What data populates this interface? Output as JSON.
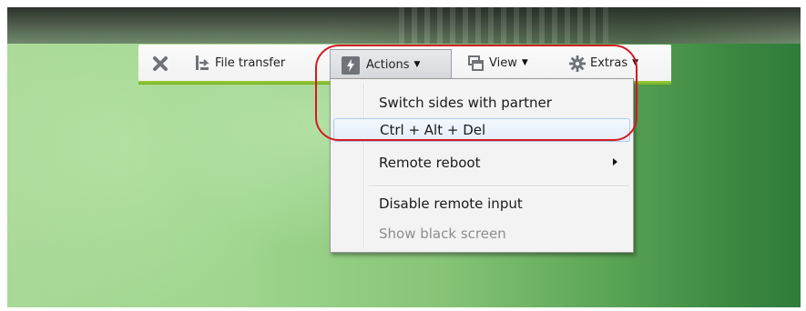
{
  "toolbar": {
    "close_icon": "close-x-icon",
    "file_transfer_label": "File transfer",
    "actions_label": "Actions",
    "view_label": "View",
    "extras_label": "Extras"
  },
  "actions_menu": {
    "items": [
      {
        "label": "Switch sides with partner",
        "state": "normal"
      },
      {
        "label": "Ctrl + Alt + Del",
        "state": "hover"
      },
      {
        "label": "Remote reboot",
        "state": "submenu"
      },
      {
        "label": "Disable remote input",
        "state": "normal"
      },
      {
        "label": "Show black screen",
        "state": "disabled"
      }
    ]
  },
  "colors": {
    "accent_strip": "#8dc232",
    "highlight_ring": "#d31a21",
    "hover_border": "#aecbec",
    "disabled_text": "#8d8d8d"
  }
}
